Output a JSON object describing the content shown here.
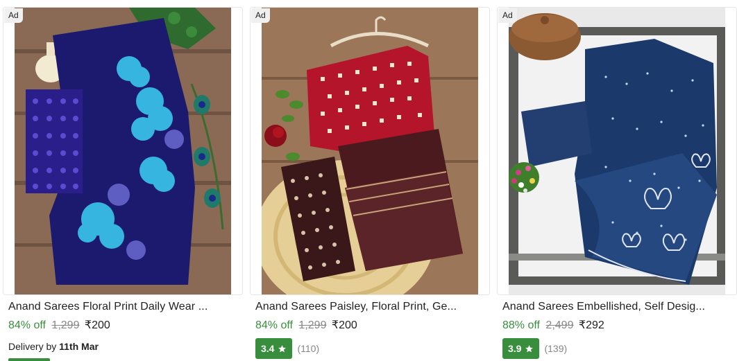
{
  "products": [
    {
      "ad_label": "Ad",
      "title": "Anand Sarees Floral Print Daily Wear ...",
      "discount": "84% off",
      "mrp": "1,299",
      "price": "₹200",
      "delivery_prefix": "Delivery by",
      "delivery_date": "11th Mar",
      "image_icon": "saree-photo-navy-floral"
    },
    {
      "ad_label": "Ad",
      "title": "Anand Sarees Paisley, Floral Print, Ge...",
      "discount": "84% off",
      "mrp": "1,299",
      "price": "₹200",
      "rating": "3.4",
      "rating_count": "(110)",
      "image_icon": "saree-photo-red-bandhani"
    },
    {
      "ad_label": "Ad",
      "title": "Anand Sarees Embellished, Self Desig...",
      "discount": "88% off",
      "mrp": "2,499",
      "price": "₹292",
      "rating": "3.9",
      "rating_count": "(139)",
      "image_icon": "saree-photo-blue-embellished"
    }
  ],
  "colors": {
    "discount_green": "#388e3c",
    "rating_green": "#388e3c",
    "mrp_grey": "#878787"
  }
}
